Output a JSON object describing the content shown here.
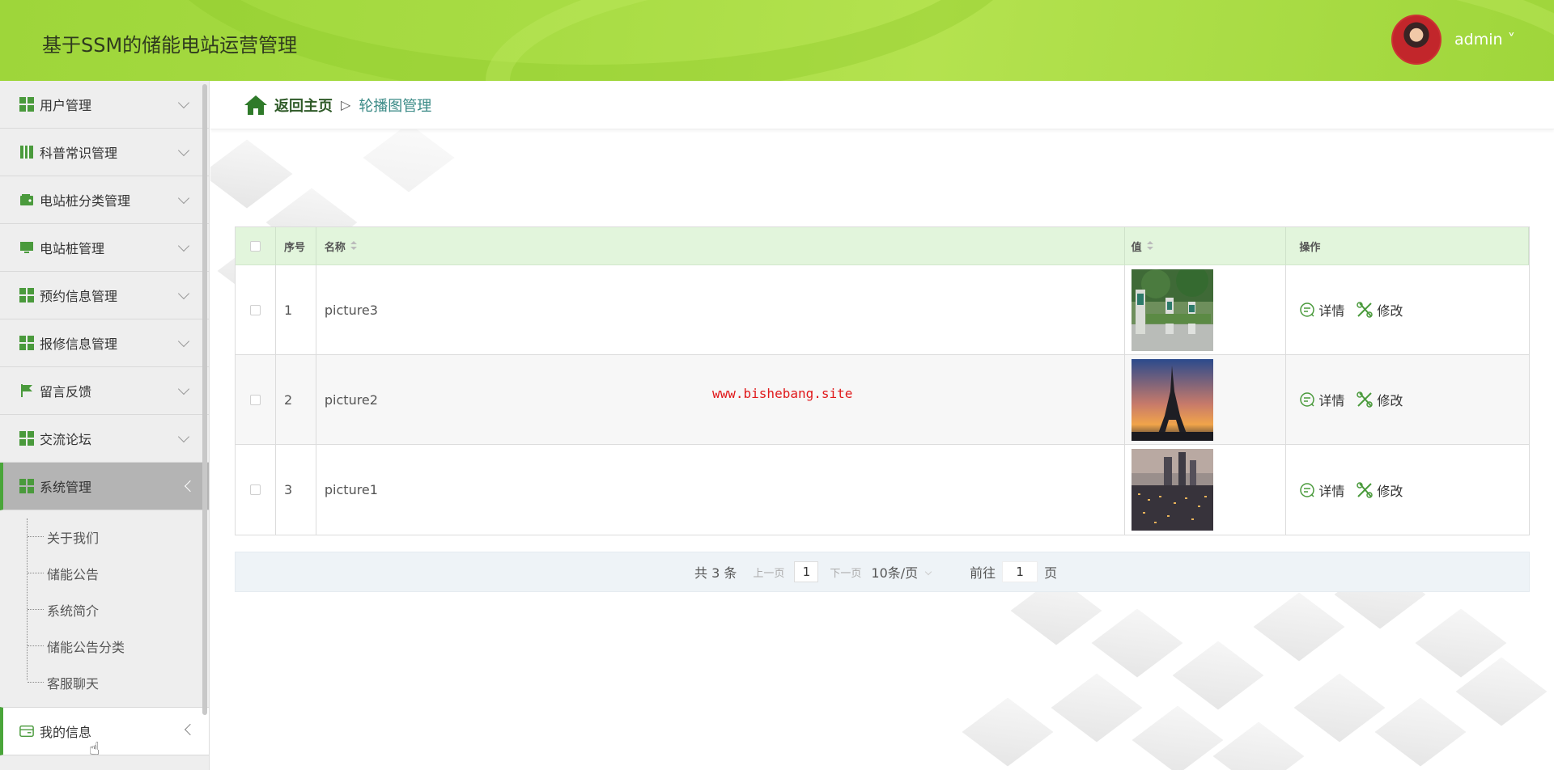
{
  "header": {
    "title": "基于SSM的储能电站运营管理",
    "user": "admin ˅"
  },
  "sidebar": {
    "items": [
      {
        "label": "用户管理",
        "icon": "grid-icon"
      },
      {
        "label": "科普常识管理",
        "icon": "book-icon"
      },
      {
        "label": "电站桩分类管理",
        "icon": "wallet-icon"
      },
      {
        "label": "电站桩管理",
        "icon": "monitor-icon"
      },
      {
        "label": "预约信息管理",
        "icon": "grid-icon"
      },
      {
        "label": "报修信息管理",
        "icon": "grid-icon"
      },
      {
        "label": "留言反馈",
        "icon": "flag-icon"
      },
      {
        "label": "交流论坛",
        "icon": "grid-icon"
      },
      {
        "label": "系统管理",
        "icon": "grid-icon"
      }
    ],
    "submenu": [
      "关于我们",
      "储能公告",
      "系统简介",
      "储能公告分类",
      "客服聊天"
    ],
    "mine": {
      "label": "我的信息",
      "icon": "card-icon"
    }
  },
  "breadcrumb": {
    "home": "返回主页",
    "sep": "▷",
    "current": "轮播图管理"
  },
  "table": {
    "headers": [
      "序号",
      "名称",
      "值",
      "操作"
    ],
    "rows": [
      {
        "index": "1",
        "name": "picture3",
        "image": "charging-station"
      },
      {
        "index": "2",
        "name": "picture2",
        "image": "eiffel-tower-sunset"
      },
      {
        "index": "3",
        "name": "picture1",
        "image": "city-skyline"
      }
    ],
    "actions": {
      "detail": "详情",
      "edit": "修改"
    }
  },
  "watermark": "www.bishebang.site",
  "pagination": {
    "total": "共 3 条",
    "prev": "上一页",
    "page": "1",
    "next": "下一页",
    "size": "10条/页",
    "goto_label": "前往",
    "goto_value": "1",
    "goto_suffix": "页"
  },
  "colors": {
    "header_green": "#a8dc44",
    "accent_green": "#4a9a3c",
    "table_header": "#e2f5dc",
    "watermark_red": "#e0191b"
  }
}
